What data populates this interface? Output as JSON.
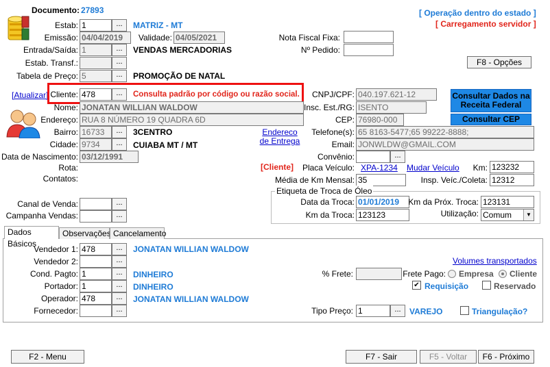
{
  "header": {
    "documento_label": "Documento:",
    "documento_value": "27893",
    "operacao": "[ Operação dentro do estado ]",
    "carregamento": "[ Carregamento servidor ]"
  },
  "top": {
    "estab_label": "Estab:",
    "estab_value": "1",
    "estab_desc": "MATRIZ - MT",
    "emissao_label": "Emissão:",
    "emissao_value": "04/04/2019",
    "validade_label": "Validade:",
    "validade_value": "04/05/2021",
    "nf_fixa_label": "Nota Fiscal Fixa:",
    "nf_fixa_value": "",
    "entrada_label": "Entrada/Saída:",
    "entrada_value": "1",
    "entrada_desc": "VENDAS MERCADORIAS",
    "pedido_label": "Nº Pedido:",
    "pedido_value": "",
    "estab_transf_label": "Estab. Transf.:",
    "estab_transf_value": "",
    "tabela_label": "Tabela de Preço:",
    "tabela_value": "5",
    "tabela_desc": "PROMOÇÃO DE NATAL",
    "f8": "F8 - Opções"
  },
  "client": {
    "atualizar": "[Atualizar]",
    "cliente_label": "Cliente:",
    "cliente_value": "478",
    "consulta_hint": "Consulta padrão por código ou razão social.",
    "cnpj_label": "CNPJ/CPF:",
    "cnpj_value": "040.197.621-12",
    "consultar_receita": "Consultar Dados na Receita Federal",
    "nome_label": "Nome:",
    "nome_value": "JONATAN WILLIAN WALDOW",
    "insc_label": "Insc. Est./RG:",
    "insc_value": "ISENTO",
    "endereco_label": "Endereço:",
    "endereco_value": "RUA 8 NÚMERO 19 QUADRA 6D",
    "cep_label": "CEP:",
    "cep_value": "76980-000",
    "consultar_cep": "Consultar CEP",
    "bairro_label": "Bairro:",
    "bairro_code": "16733",
    "bairro_desc": "3CENTRO",
    "endereco_entrega": "Endereco de Entrega",
    "telefone_label": "Telefone(s):",
    "telefone_value": "65 8163-5477;65 99222-8888;",
    "cidade_label": "Cidade:",
    "cidade_code": "9734",
    "cidade_desc": "CUIABA  MT / MT",
    "email_label": "Email:",
    "email_value": "JONWLDW@GMAIL.COM",
    "nascimento_label": "Data de Nascimento:",
    "nascimento_value": "03/12/1991",
    "convenio_label": "Convênio:",
    "convenio_value": "",
    "rota_label": "Rota:",
    "cliente_tag": "[Cliente]",
    "placa_label": "Placa Veículo:",
    "placa_value": "XPA-1234",
    "mudar_veiculo": "Mudar Veículo",
    "km_label": "Km:",
    "km_value": "123232",
    "contatos_label": "Contatos:",
    "media_km_label": "Média de Km Mensal:",
    "media_km_value": "35",
    "insp_label": "Insp. Veíc./Coleta:",
    "insp_value": "12312"
  },
  "oleo": {
    "legend": "Etiqueta de Troca de Óleo",
    "data_troca_label": "Data da Troca:",
    "data_troca_value": "01/01/2019",
    "km_prox_label": "Km da Próx. Troca:",
    "km_prox_value": "123131",
    "km_troca_label": "Km da Troca:",
    "km_troca_value": "123123",
    "utilizacao_label": "Utilização:",
    "utilizacao_value": "Comum"
  },
  "canal": {
    "canal_label": "Canal de Venda:",
    "canal_value": "",
    "campanha_label": "Campanha Vendas:",
    "campanha_value": ""
  },
  "tabs": [
    {
      "label": "Dados Básicos"
    },
    {
      "label": "Observações"
    },
    {
      "label": "Cancelamento"
    }
  ],
  "basic": {
    "vendedor1_label": "Vendedor 1:",
    "vendedor1_value": "478",
    "vendedor1_desc": "JONATAN WILLIAN WALDOW",
    "vendedor2_label": "Vendedor 2:",
    "vendedor2_value": "",
    "volumes": "Volumes transportados",
    "cond_label": "Cond. Pagto:",
    "cond_value": "1",
    "cond_desc": "DINHEIRO",
    "frete_label": "% Frete:",
    "frete_value": "",
    "frete_pago_label": "Frete Pago:",
    "empresa": "Empresa",
    "cliente": "Cliente",
    "portador_label": "Portador:",
    "portador_value": "1",
    "portador_desc": "DINHEIRO",
    "requisicao": "Requisição",
    "reservado": "Reservado",
    "operador_label": "Operador:",
    "operador_value": "478",
    "operador_desc": "JONATAN WILLIAN WALDOW",
    "fornecedor_label": "Fornecedor:",
    "fornecedor_value": "",
    "tipo_preco_label": "Tipo Preço:",
    "tipo_preco_value": "1",
    "tipo_preco_desc": "VAREJO",
    "triangulacao": "Triangulação?"
  },
  "footer": {
    "f2": "F2 - Menu",
    "f7": "F7 - Sair",
    "f5": "F5 - Voltar",
    "f6": "F6 - Próximo"
  },
  "dots_label": "...",
  "check_mark": "✔",
  "colors": {
    "accent_blue": "#1e7bd6",
    "alert_red": "#e1251b",
    "button_blue": "#1e88e5"
  }
}
